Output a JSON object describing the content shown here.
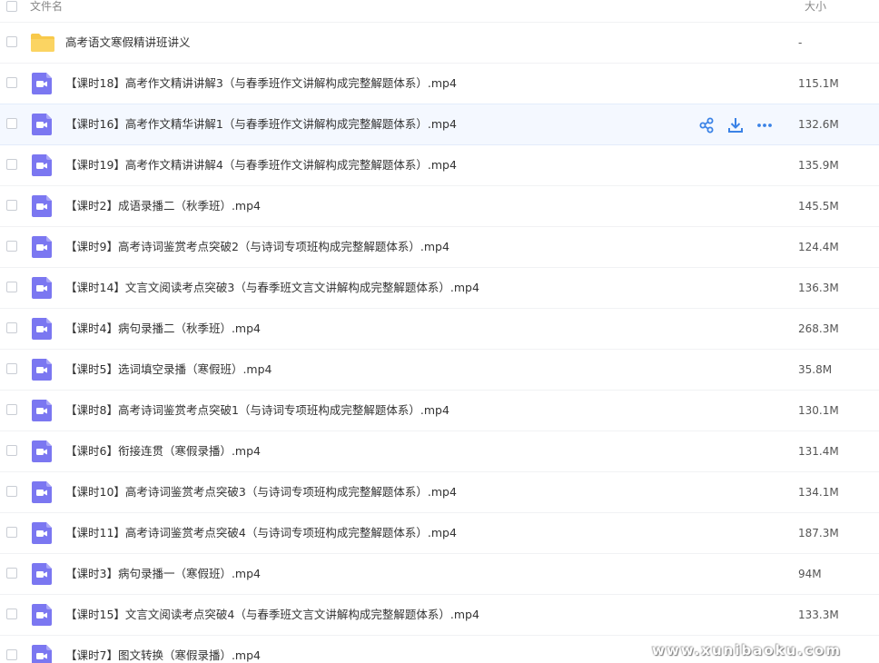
{
  "header": {
    "name_label": "文件名",
    "size_label": "大小"
  },
  "colors": {
    "folder": "#f8c94a",
    "video": "#7b77f1",
    "action": "#3a82e6"
  },
  "rows": [
    {
      "type": "folder",
      "name": "高考语文寒假精讲班讲义",
      "size": "-"
    },
    {
      "type": "video",
      "name": "【课时18】高考作文精讲讲解3（与春季班作文讲解构成完整解题体系）.mp4",
      "size": "115.1M"
    },
    {
      "type": "video",
      "name": "【课时16】高考作文精华讲解1（与春季班作文讲解构成完整解题体系）.mp4",
      "size": "132.6M",
      "hover": true
    },
    {
      "type": "video",
      "name": "【课时19】高考作文精讲讲解4（与春季班作文讲解构成完整解题体系）.mp4",
      "size": "135.9M"
    },
    {
      "type": "video",
      "name": "【课时2】成语录播二（秋季班）.mp4",
      "size": "145.5M"
    },
    {
      "type": "video",
      "name": "【课时9】高考诗词鉴赏考点突破2（与诗词专项班构成完整解题体系）.mp4",
      "size": "124.4M"
    },
    {
      "type": "video",
      "name": "【课时14】文言文阅读考点突破3（与春季班文言文讲解构成完整解题体系）.mp4",
      "size": "136.3M"
    },
    {
      "type": "video",
      "name": "【课时4】病句录播二（秋季班）.mp4",
      "size": "268.3M"
    },
    {
      "type": "video",
      "name": "【课时5】选词填空录播（寒假班）.mp4",
      "size": "35.8M"
    },
    {
      "type": "video",
      "name": "【课时8】高考诗词鉴赏考点突破1（与诗词专项班构成完整解题体系）.mp4",
      "size": "130.1M"
    },
    {
      "type": "video",
      "name": "【课时6】衔接连贯（寒假录播）.mp4",
      "size": "131.4M"
    },
    {
      "type": "video",
      "name": "【课时10】高考诗词鉴赏考点突破3（与诗词专项班构成完整解题体系）.mp4",
      "size": "134.1M"
    },
    {
      "type": "video",
      "name": "【课时11】高考诗词鉴赏考点突破4（与诗词专项班构成完整解题体系）.mp4",
      "size": "187.3M"
    },
    {
      "type": "video",
      "name": "【课时3】病句录播一（寒假班）.mp4",
      "size": "94M"
    },
    {
      "type": "video",
      "name": "【课时15】文言文阅读考点突破4（与春季班文言文讲解构成完整解题体系）.mp4",
      "size": "133.3M"
    },
    {
      "type": "video",
      "name": "【课时7】图文转换（寒假录播）.mp4",
      "size": ""
    }
  ],
  "watermark": "www.xunibaoku.com"
}
